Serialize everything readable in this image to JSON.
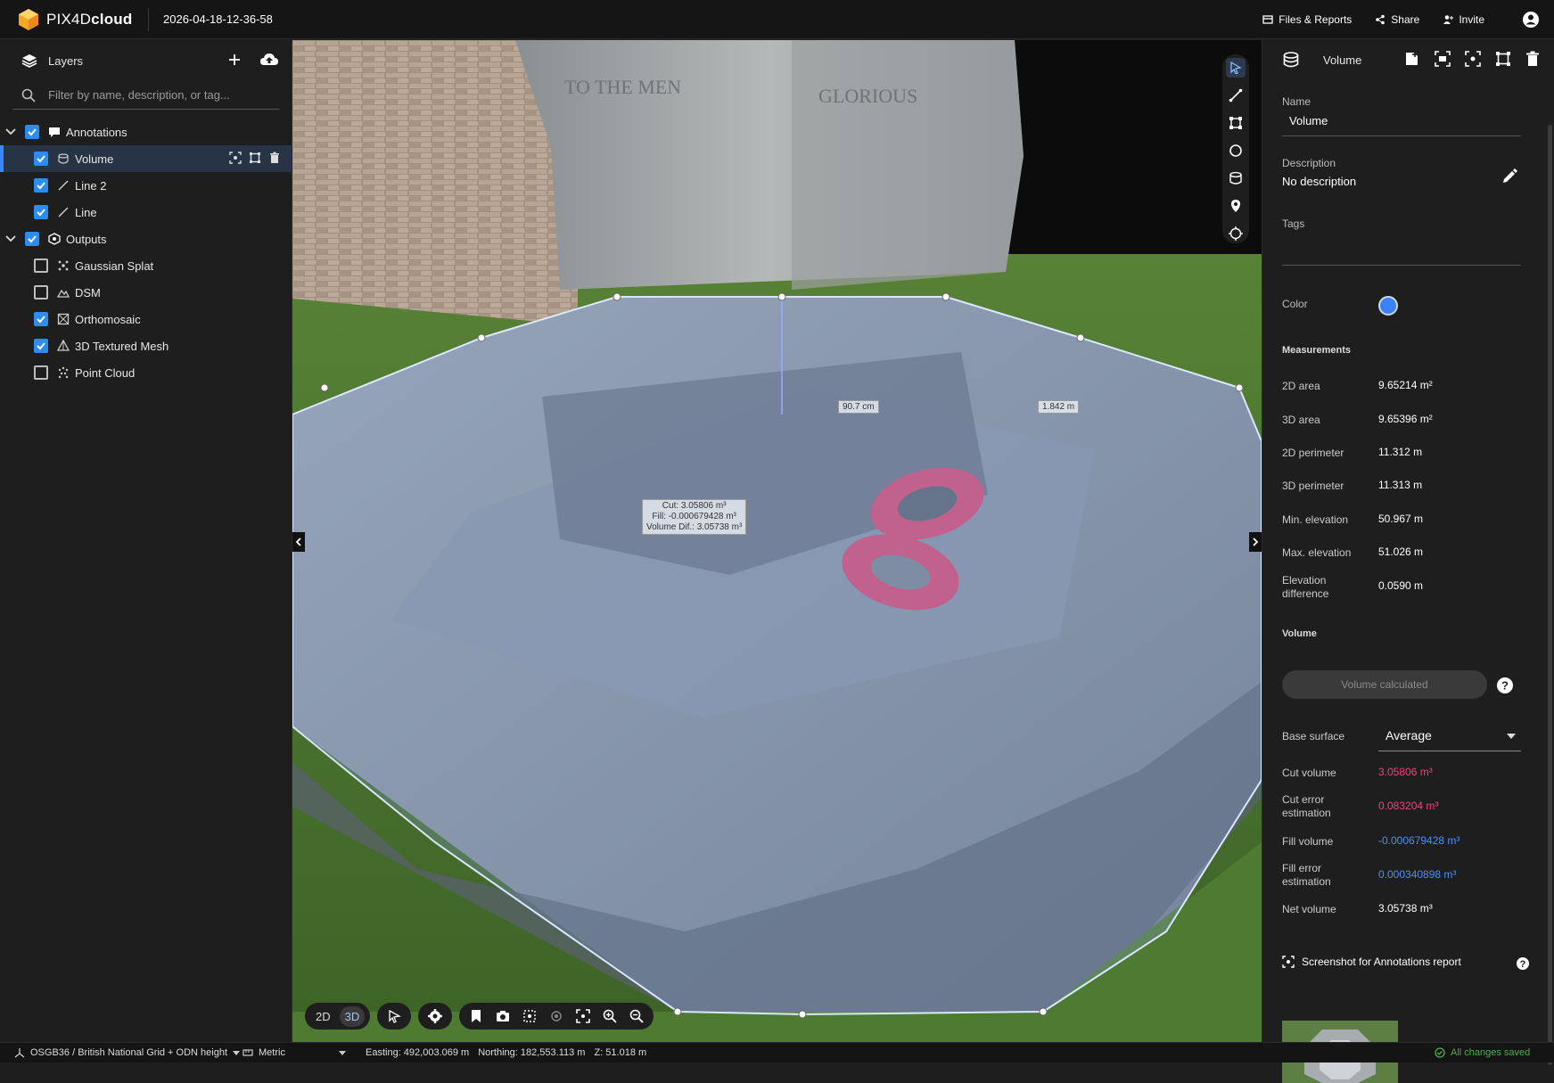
{
  "app": {
    "brand_light": "PIX4D",
    "brand_bold": "cloud",
    "project_name": "2026-04-18-12-36-58",
    "files_reports": "Files & Reports",
    "share": "Share",
    "invite": "Invite"
  },
  "layers": {
    "title": "Layers",
    "filter_placeholder": "Filter by name, description, or tag...",
    "groups": [
      {
        "label": "Annotations",
        "checked": true,
        "items": [
          {
            "label": "Volume",
            "checked": true,
            "selected": true,
            "icon": "volume-icon"
          },
          {
            "label": "Line 2",
            "checked": true,
            "icon": "line-icon"
          },
          {
            "label": "Line",
            "checked": true,
            "icon": "line-icon"
          }
        ]
      },
      {
        "label": "Outputs",
        "checked": true,
        "items": [
          {
            "label": "Gaussian Splat",
            "checked": false,
            "icon": "splat-icon"
          },
          {
            "label": "DSM",
            "checked": false,
            "icon": "dsm-icon"
          },
          {
            "label": "Orthomosaic",
            "checked": true,
            "icon": "orthomosaic-icon"
          },
          {
            "label": "3D Textured Mesh",
            "checked": true,
            "icon": "mesh-icon"
          },
          {
            "label": "Point Cloud",
            "checked": false,
            "icon": "point-cloud-icon"
          }
        ]
      }
    ]
  },
  "viewport": {
    "label_height": "90.7 cm",
    "label_length": "1.842 m",
    "volume_label": [
      "Cut: 3.05806 m³",
      "Fill: -0.000679428 m³",
      "Volume Dif.: 3.05738 m³"
    ],
    "mode_2d": "2D",
    "mode_3d": "3D",
    "active_mode": "3D"
  },
  "details": {
    "header_title": "Volume",
    "name_label": "Name",
    "name_value": "Volume",
    "description_label": "Description",
    "description_value": "No description",
    "tags_label": "Tags",
    "color_label": "Color",
    "color_value": "#3b82f6",
    "measurements_title": "Measurements",
    "measurements": [
      {
        "label": "2D area",
        "value": "9.65214 m²"
      },
      {
        "label": "3D area",
        "value": "9.65396 m²"
      },
      {
        "label": "2D perimeter",
        "value": "11.312 m"
      },
      {
        "label": "3D perimeter",
        "value": "11.313 m"
      },
      {
        "label": "Min. elevation",
        "value": "50.967 m"
      },
      {
        "label": "Max. elevation",
        "value": "51.026 m"
      },
      {
        "label": "Elevation difference",
        "value": "0.0590 m"
      }
    ],
    "volume_title": "Volume",
    "volume_button": "Volume calculated",
    "base_surface_label": "Base surface",
    "base_surface_value": "Average",
    "volumes": [
      {
        "label": "Cut volume",
        "value": "3.05806 m³",
        "color": "#f0457a"
      },
      {
        "label": "Cut error estimation",
        "value": "0.083204 m³",
        "color": "#f0457a"
      },
      {
        "label": "Fill volume",
        "value": "-0.000679428 m³",
        "color": "#4f8ff7"
      },
      {
        "label": "Fill error estimation",
        "value": "0.000340898 m³",
        "color": "#4f8ff7"
      },
      {
        "label": "Net volume",
        "value": "3.05738 m³",
        "color": "#ffffff"
      }
    ],
    "screenshot_title": "Screenshot for Annotations report"
  },
  "status": {
    "crs": "OSGB36 / British National Grid + ODN height",
    "units": "Metric",
    "easting": "Easting: 492,003.069 m",
    "northing": "Northing: 182,553.113 m",
    "z": "Z: 51.018 m",
    "saved": "All changes saved"
  }
}
